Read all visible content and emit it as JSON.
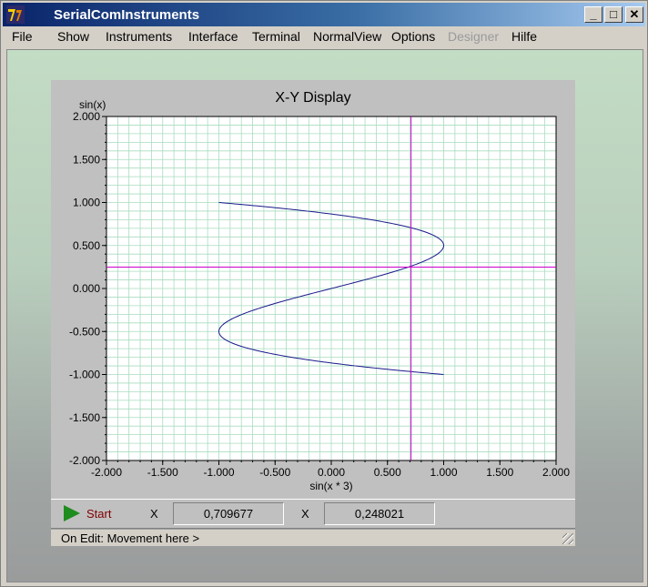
{
  "window": {
    "title": "SerialComInstruments",
    "controls": {
      "minimize": "_",
      "maximize": "□",
      "close": "✕"
    }
  },
  "menu": [
    "File",
    "Show",
    "Instruments",
    "Interface",
    "Terminal",
    "NormalView",
    "Options",
    "Designer",
    "Hilfe"
  ],
  "menu_disabled": [
    "Designer"
  ],
  "chart_data": {
    "type": "line",
    "title": "X-Y  Display",
    "xlabel": "sin(x * 3)",
    "ylabel": "sin(x)",
    "xlim": [
      -2.0,
      2.0
    ],
    "ylim": [
      -2.0,
      2.0
    ],
    "x_ticks": [
      "-2.000",
      "-1.500",
      "-1.000",
      "-0.500",
      "0.000",
      "0.500",
      "1.000",
      "1.500",
      "2.000"
    ],
    "y_ticks": [
      "2.000",
      "1.500",
      "1.000",
      "0.500",
      "0.000",
      "-0.500",
      "-1.000",
      "-1.500",
      "-2.000"
    ],
    "grid": true,
    "curve": {
      "x_function": "sin(3t)",
      "y_function": "sin(t)",
      "t_range": [
        0,
        6.2832
      ],
      "color": "#1a1a8c"
    },
    "cursor": {
      "x": 0.709677,
      "y": 0.248021,
      "color": "#cc00cc"
    },
    "grid_color": "#a8dcc0"
  },
  "controls": {
    "start_label": "Start",
    "x_label": "X",
    "x_value": "0,709677",
    "y_label": "X",
    "y_value": "0,248021"
  },
  "status": "On Edit:  Movement here >"
}
